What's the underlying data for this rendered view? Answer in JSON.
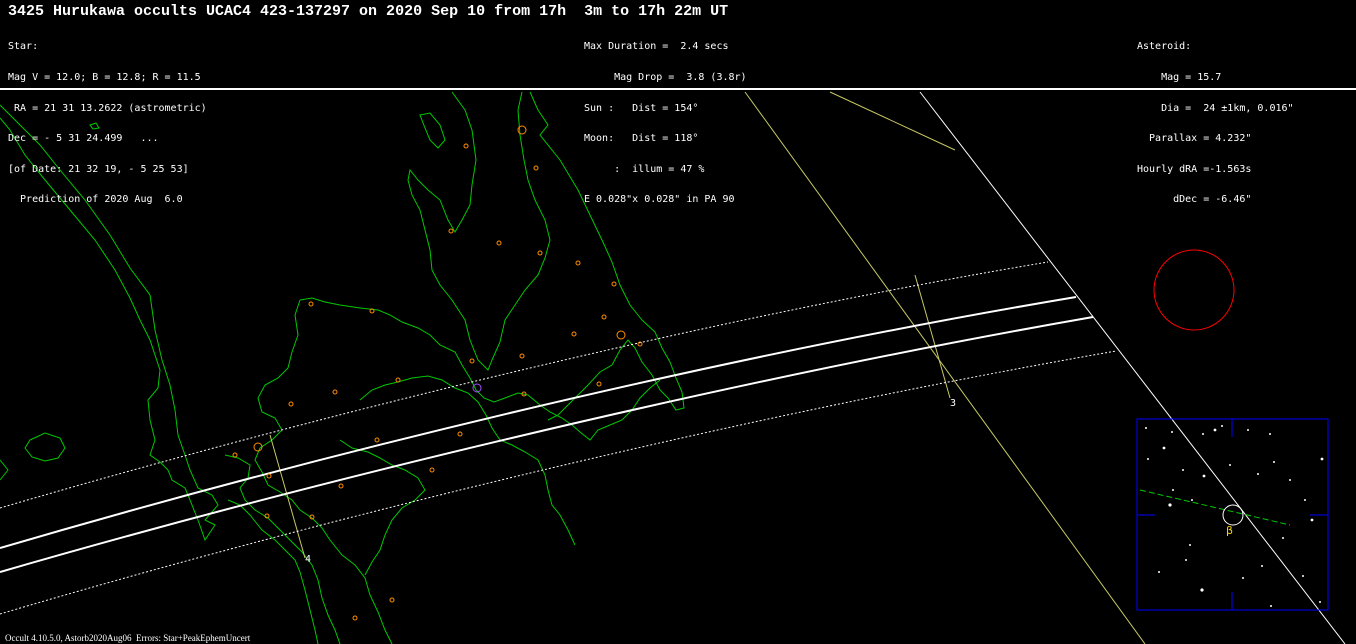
{
  "title": "3425 Hurukawa occults UCAC4 423-137297 on 2020 Sep 10 from 17h  3m to 17h 22m UT",
  "star_block": [
    "Star:",
    "Mag V = 12.0; B = 12.8; R = 11.5",
    " RA = 21 31 13.2622 (astrometric)",
    "Dec = - 5 31 24.499   ...",
    "[of Date: 21 32 19, - 5 25 53]",
    "  Prediction of 2020 Aug  6.0"
  ],
  "event_block": [
    "Max Duration =  2.4 secs",
    "     Mag Drop =  3.8 (3.8r)",
    "Sun :   Dist = 154°",
    "Moon:   Dist = 118°",
    "     :  illum = 47 %",
    "E 0.028\"x 0.028\" in PA 90"
  ],
  "asteroid_block": [
    "Asteroid:",
    "    Mag = 15.7",
    "    Dia =  24 ±1km, 0.016\"",
    "  Parallax = 4.232\"",
    "Hourly dRA =-1.563s",
    "      dDec = -6.46\""
  ],
  "time_markers": [
    "3",
    "4"
  ],
  "finder_chart": {
    "target_symbol": "β"
  },
  "footer": "Occult 4.10.5.0, Astorb2020Aug06  Errors: Star+PeakEphemUncert",
  "colors": {
    "background": "#000000",
    "coastline": "#00c800",
    "path_lines": "#ffffff",
    "sun_terminator": "#c8c864",
    "cities": "#ff8c00",
    "moon_circle": "#ff0000",
    "finder_frame": "#0000ff",
    "target_marker": "#ffd700"
  }
}
